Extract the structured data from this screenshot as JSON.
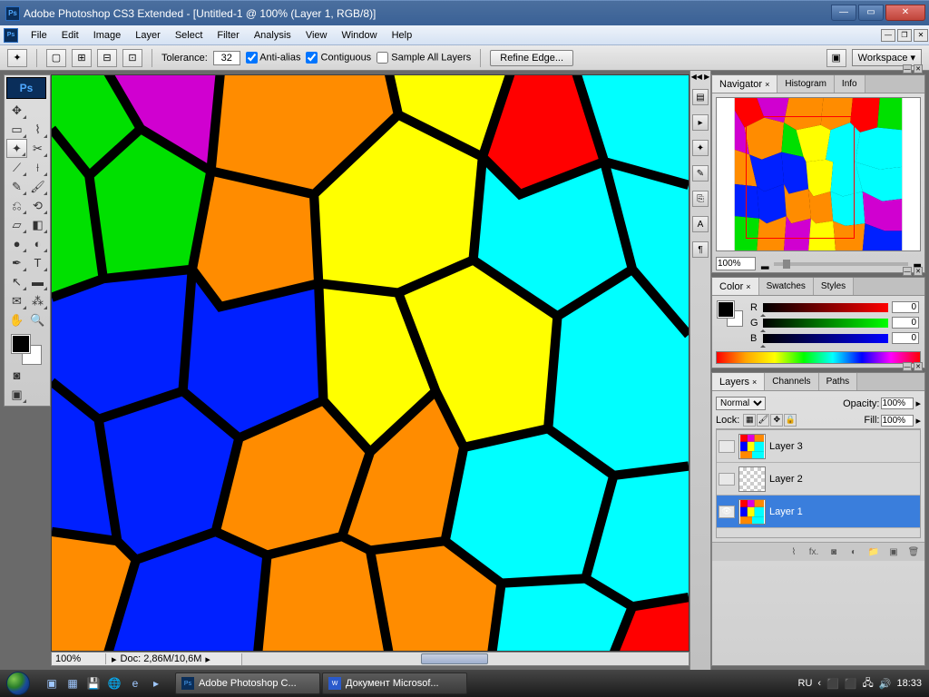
{
  "titlebar": {
    "title": "Adobe Photoshop CS3 Extended - [Untitled-1 @ 100% (Layer 1, RGB/8)]"
  },
  "menu": {
    "items": [
      "File",
      "Edit",
      "Image",
      "Layer",
      "Select",
      "Filter",
      "Analysis",
      "View",
      "Window",
      "Help"
    ]
  },
  "options": {
    "tolerance_label": "Tolerance:",
    "tolerance": "32",
    "antialias": "Anti-alias",
    "contiguous": "Contiguous",
    "sample_all": "Sample All Layers",
    "refine": "Refine Edge...",
    "workspace": "Workspace"
  },
  "toolbox": {
    "ps": "Ps"
  },
  "statusbar": {
    "zoom": "100%",
    "docinfo": "Doc: 2,86M/10,6M"
  },
  "navigator": {
    "tabs": [
      "Navigator",
      "Histogram",
      "Info"
    ],
    "zoom": "100%"
  },
  "color": {
    "tabs": [
      "Color",
      "Swatches",
      "Styles"
    ],
    "r_label": "R",
    "g_label": "G",
    "b_label": "B",
    "r": "0",
    "g": "0",
    "b": "0"
  },
  "layers": {
    "tabs": [
      "Layers",
      "Channels",
      "Paths"
    ],
    "blend": "Normal",
    "opacity_label": "Opacity:",
    "opacity": "100%",
    "lock_label": "Lock:",
    "fill_label": "Fill:",
    "fill": "100%",
    "items": [
      {
        "name": "Layer 3",
        "visible": false
      },
      {
        "name": "Layer 2",
        "visible": false
      },
      {
        "name": "Layer 1",
        "visible": true
      }
    ]
  },
  "taskbar": {
    "apps": [
      {
        "label": "Adobe Photoshop C...",
        "icon": "Ps"
      },
      {
        "label": "Документ Microsof...",
        "icon": "W"
      }
    ],
    "lang": "RU",
    "time": "18:33"
  }
}
